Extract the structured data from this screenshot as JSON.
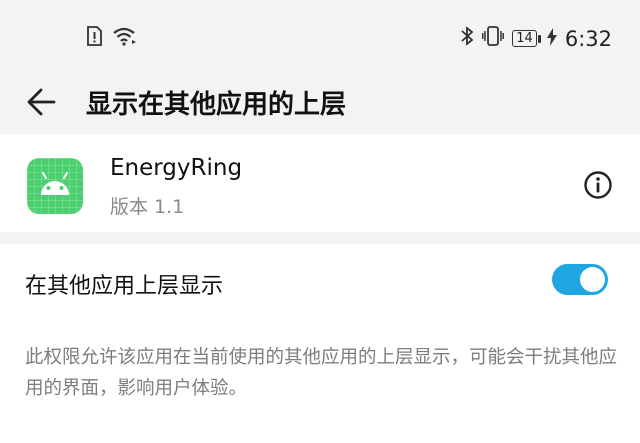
{
  "status_bar": {
    "time": "6:32",
    "battery_level": "14",
    "icons": [
      "sim-alert-icon",
      "wifi-icon",
      "bluetooth-icon",
      "vibrate-icon",
      "battery-icon",
      "charging-icon"
    ]
  },
  "toolbar": {
    "title": "显示在其他应用的上层",
    "back_icon": "back-arrow-icon"
  },
  "app": {
    "name": "EnergyRing",
    "version": "版本 1.1",
    "icon": "android-robot-icon",
    "icon_color": "#4ccf6e",
    "info_icon": "info-icon"
  },
  "permission": {
    "label": "在其他应用上层显示",
    "toggle_on": true,
    "toggle_color": "#1fa6e0",
    "description": "此权限允许该应用在当前使用的其他应用的上层显示，可能会干扰其他应用的界面，影响用户体验。"
  }
}
